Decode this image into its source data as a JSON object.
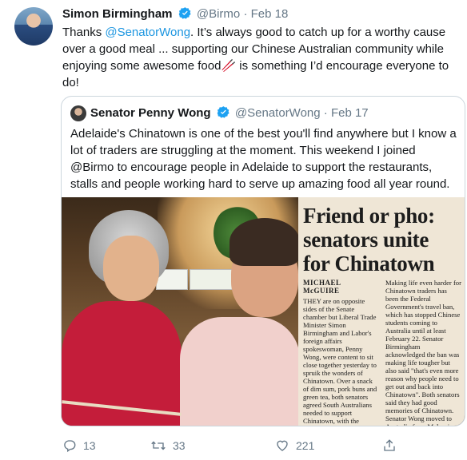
{
  "tweet": {
    "display_name": "Simon Birmingham",
    "handle": "@Birmo",
    "separator": "·",
    "date": "Feb 18",
    "text_before_mention": "Thanks ",
    "mention": "@SenatorWong",
    "text_after_mention": ". It’s always good to catch up for a worthy cause over a good meal ... supporting our Chinese Australian community while enjoying some awesome food",
    "emoji": "🥢",
    "text_end": " is something I’d encourage everyone to do!"
  },
  "quoted_tweet": {
    "display_name": "Senator Penny Wong",
    "handle": "@SenatorWong",
    "separator": "·",
    "date": "Feb 17",
    "text": "Adelaide's Chinatown is one of the best you'll find anywhere but I know a lot of traders are struggling at the moment. This weekend I joined @Birmo to encourage people in Adelaide to support the restaurants, stalls and people working hard to serve up amazing food all year round."
  },
  "newspaper": {
    "headline_line1": "Friend or pho:",
    "headline_line2": "senators unite",
    "headline_line3": "for Chinatown",
    "byline": "MICHAEL McGUIRE",
    "col1": "THEY are on opposite sides of the Senate chamber but Liberal Trade Minister Simon Birmingham and Labor's foreign affairs spokeswoman, Penny Wong, were content to sit close together yesterday to spruik the wonders of Chinatown. Over a snack of dim sum, pork buns and green tea, both senators agreed South Australians needed to support Chinatown, with the restaurant and food centre quieter than usual because",
    "col2": "Making life even harder for Chinatown traders has been the Federal Government's travel ban, which has stopped Chinese students coming to Australia until at least February 22. Senator Birmingham acknowledged the ban was making life tougher but also said \"that's even more reason why people need to get out and back into Chinatown\". Both senators said they had good memories of Chinatown. Senator Wong moved to Australia from Malaysia when she was"
  },
  "actions": {
    "replies": "13",
    "retweets": "33",
    "likes": "221"
  },
  "colors": {
    "link": "#1b95e0",
    "verified": "#1da1f2",
    "muted": "#657786"
  }
}
